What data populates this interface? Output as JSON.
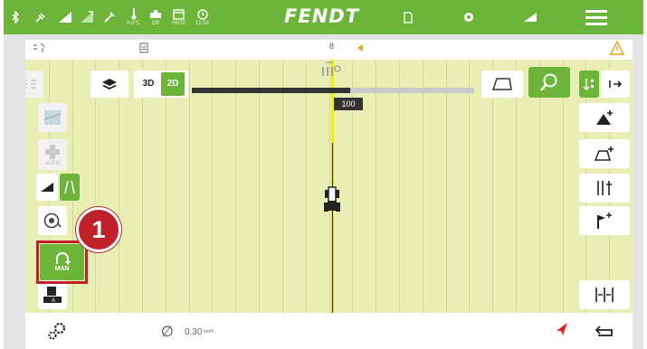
{
  "status_bar": {
    "brand": "FENDT",
    "temperature": "0.0°C",
    "status_off": "Off",
    "date": "06/10",
    "time": "12:52",
    "icons": [
      "bluetooth-icon",
      "signal-icon",
      "gps-icon",
      "temperature-icon",
      "work-lights-icon",
      "calendar-icon",
      "clock-icon",
      "sim-icon",
      "sd-card-icon",
      "network-icon"
    ]
  },
  "info_strip": {
    "boom_count": "8"
  },
  "map": {
    "scale_label": "100",
    "scale_level_percent": 56,
    "stripe_count": 25
  },
  "view_toggle": {
    "label_3d": "3D",
    "label_2d": "2D",
    "active": "2D"
  },
  "sidebar_left": {
    "auto_label": "AUTO",
    "man_label": "MAN"
  },
  "callout": {
    "number": "1"
  },
  "bottom_bar": {
    "speed_value": "0.30",
    "speed_unit": "km/h"
  },
  "colors": {
    "brand_green": "#6cb43a",
    "field": "#e9efb4",
    "guidance_line": "#f2f000",
    "callout_red": "#c0202a"
  }
}
